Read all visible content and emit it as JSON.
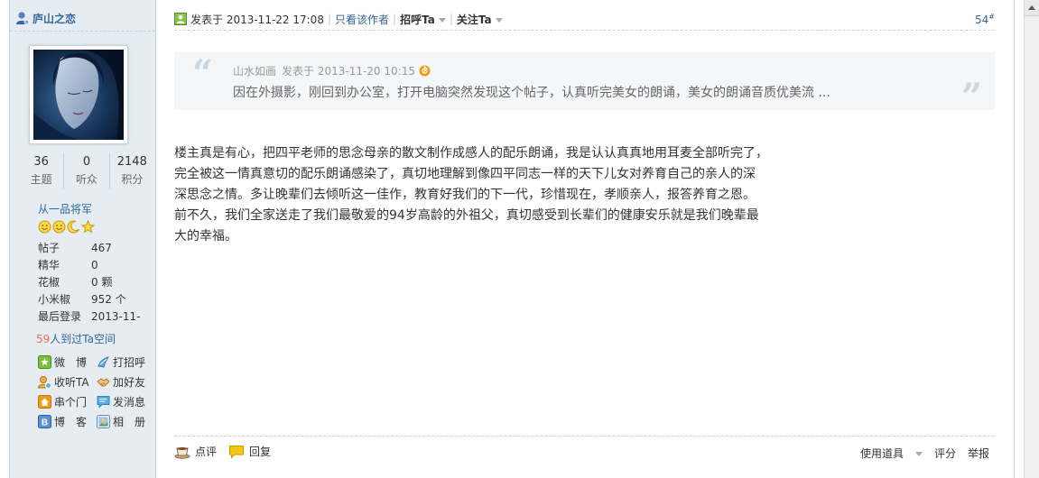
{
  "sidebar": {
    "author_name": "庐山之恋",
    "stats": [
      {
        "num": "36",
        "label": "主题"
      },
      {
        "num": "0",
        "label": "听众"
      },
      {
        "num": "2148",
        "label": "积分"
      }
    ],
    "rank": "从一品将军",
    "info": [
      {
        "key": "帖子",
        "value": "467"
      },
      {
        "key": "精华",
        "value": "0"
      },
      {
        "key": "花椒",
        "value": "0 颗"
      },
      {
        "key": "小米椒",
        "value": "952 个"
      },
      {
        "key": "最后登录",
        "value": "2013-11-"
      }
    ],
    "visits_count": "59",
    "visits_text": "人到过Ta空间",
    "actions": [
      {
        "label": "微　博"
      },
      {
        "label": "打招呼"
      },
      {
        "label": "收听TA"
      },
      {
        "label": "加好友"
      },
      {
        "label": "串个门"
      },
      {
        "label": "发消息"
      },
      {
        "label": "博　客"
      },
      {
        "label": "相　册"
      }
    ]
  },
  "post": {
    "posted_at": "发表于 2013-11-22 17:08",
    "only_author": "只看该作者",
    "greet": "招呼Ta",
    "follow": "关注Ta",
    "floor": "54",
    "floor_sup": "#",
    "quote": {
      "author": "山水如画",
      "posted_at": "发表于 2013-11-20 10:15",
      "text": "因在外摄影，刚回到办公室，打开电脑突然发现这个帖子，认真听完美女的朗诵，美女的朗诵音质优美流 ..."
    },
    "body_lines": [
      "楼主真是有心，把四平老师的思念母亲的散文制作成感人的配乐朗诵，我是认认真真地用耳麦全部听完了，",
      "完全被这一情真意切的配乐朗诵感染了，真切地理解到像四平同志一样的天下儿女对养育自己的亲人的深",
      "深思念之情。多让晚辈们去倾听这一佳作，教育好我们的下一代，珍惜现在，孝顺亲人，报答养育之恩。",
      "前不久，我们全家送走了我们最敬爱的94岁高龄的外祖父，真切感受到长辈们的健康安乐就是我们晚辈最",
      "大的幸福。"
    ],
    "footer": {
      "comment": "点评",
      "reply": "回复",
      "tools": "使用道具",
      "rate": "评分",
      "report": "举报"
    }
  },
  "colors": {
    "sidebar_bg": "#e5edf2",
    "link": "#336699",
    "accent": "#f26c4f"
  }
}
